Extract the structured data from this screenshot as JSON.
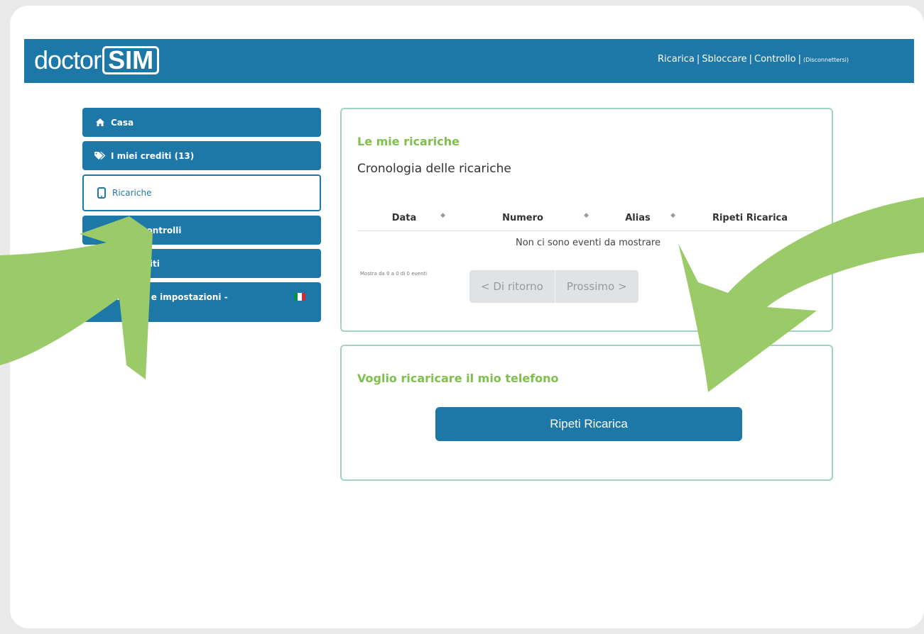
{
  "brand": {
    "logo_text": "doctor",
    "logo_box": "SIM"
  },
  "topnav": {
    "ricarica": "Ricarica",
    "sbloccare": "Sbloccare",
    "controllo": "Controllo",
    "disconnect": "(Disconnettersi)"
  },
  "sidebar": {
    "items": [
      {
        "label": "Casa",
        "icon": "home-icon"
      },
      {
        "label": "I miei crediti (13)",
        "icon": "tags-icon"
      },
      {
        "label": "Ricariche",
        "icon": "mobile-phone-icon",
        "active": true
      },
      {
        "label": "cchi e controlli",
        "icon": ""
      },
      {
        "label": "sta crediti",
        "icon": ""
      },
      {
        "label": "mazioni e impostazioni -",
        "icon": ""
      }
    ]
  },
  "panel1": {
    "title": "Le mie ricariche",
    "subtitle": "Cronologia delle ricariche",
    "columns": [
      "Data",
      "Numero",
      "Alias",
      "Ripeti Ricarica"
    ],
    "empty_message": "Non ci sono eventi da mostrare",
    "pager_info": "Mostra da 0 a 0 di 0 eventi",
    "prev_label": "< Di ritorno",
    "next_label": "Prossimo >"
  },
  "panel2": {
    "title": "Voglio ricaricare il mio telefono",
    "button_label": "Ripeti Ricarica"
  },
  "colors": {
    "primary": "#1d78a8",
    "accent_green": "#7fbf4d",
    "arrow_green": "#9bcb69",
    "panel_border": "#9fd3c4"
  }
}
